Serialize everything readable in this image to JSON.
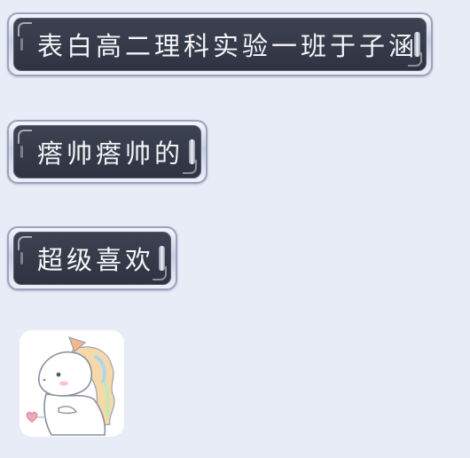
{
  "messages": [
    {
      "text": "表白高二理科实验一班于子涵"
    },
    {
      "text": "瘩帅瘩帅的"
    },
    {
      "text": "超级喜欢"
    }
  ],
  "sticker": {
    "icon": "unicorn-sticker-icon"
  },
  "colors": {
    "background": "#e8ecf6",
    "bubble_fill": "#3a3f4f",
    "bubble_frame": "#c9cfe0",
    "text": "#f4f5f8"
  }
}
